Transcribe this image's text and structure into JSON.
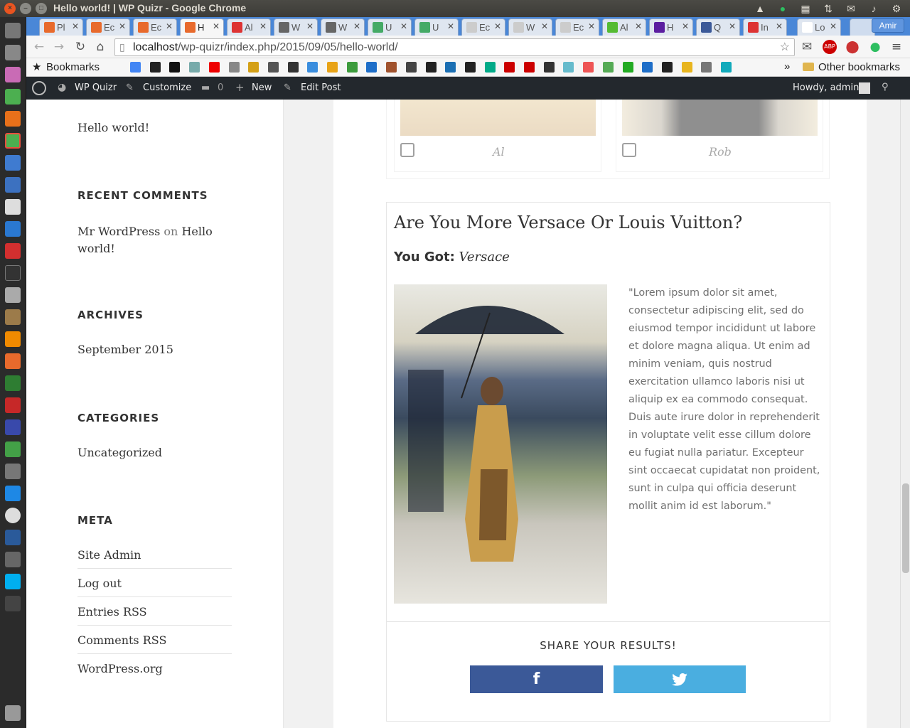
{
  "window": {
    "title": "Hello world! | WP Quizr - Google Chrome"
  },
  "tabs": [
    {
      "label": "Pl",
      "fav": "#e86a2c"
    },
    {
      "label": "Ec",
      "fav": "#e86a2c"
    },
    {
      "label": "Ec",
      "fav": "#e86a2c"
    },
    {
      "label": "H",
      "fav": "#e86a2c"
    },
    {
      "label": "Al",
      "fav": "#d33"
    },
    {
      "label": "W",
      "fav": "#666"
    },
    {
      "label": "W",
      "fav": "#666"
    },
    {
      "label": "U",
      "fav": "#4a6"
    },
    {
      "label": "U",
      "fav": "#4a6"
    },
    {
      "label": "Ec",
      "fav": "#ccc"
    },
    {
      "label": "W",
      "fav": "#ccc"
    },
    {
      "label": "Ec",
      "fav": "#ccc"
    },
    {
      "label": "Al",
      "fav": "#5b3"
    },
    {
      "label": "H",
      "fav": "#5c1ea0"
    },
    {
      "label": "Q",
      "fav": "#3b5998"
    },
    {
      "label": "In",
      "fav": "#d33"
    },
    {
      "label": "Lo",
      "fav": "#fff"
    }
  ],
  "profile_name": "Amir",
  "url": {
    "host": "localhost",
    "path": "/wp-quizr/index.php/2015/09/05/hello-world/"
  },
  "bookmarks": {
    "label": "Bookmarks",
    "other": "Other bookmarks"
  },
  "adminbar": {
    "site": "WP Quizr",
    "customize": "Customize",
    "comments": "0",
    "new": "New",
    "edit": "Edit Post",
    "howdy": "Howdy, admin"
  },
  "sidebar": {
    "recent_post": "Hello world!",
    "recent_comments_title": "RECENT COMMENTS",
    "comment_author": "Mr WordPress",
    "comment_on": "on",
    "comment_post_1": "Hello",
    "comment_post_2": "world!",
    "archives_title": "ARCHIVES",
    "archive_item": "September 2015",
    "categories_title": "CATEGORIES",
    "category_item": "Uncategorized",
    "meta_title": "META",
    "meta": [
      "Site Admin",
      "Log out",
      "Entries RSS",
      "Comments RSS",
      "WordPress.org"
    ]
  },
  "quiz": {
    "choice_a": "Al",
    "choice_b": "Rob",
    "question": "Are You More Versace Or Louis Vuitton?",
    "you_got_label": "You Got:",
    "result": "Versace",
    "description": "\"Lorem ipsum dolor sit amet, consectetur adipiscing elit, sed do eiusmod tempor incididunt ut labore et dolore magna aliqua. Ut enim ad minim veniam, quis nostrud exercitation ullamco laboris nisi ut aliquip ex ea commodo consequat. Duis aute irure dolor in reprehenderit in voluptate velit esse cillum dolore eu fugiat nulla pariatur. Excepteur sint occaecat cupidatat non proident, sunt in culpa qui officia deserunt mollit anim id est laborum.\"",
    "share_title": "SHARE YOUR RESULTS!",
    "facebook_glyph": "f",
    "facebook_color": "#3b5998",
    "twitter_color": "#4aaee0"
  }
}
